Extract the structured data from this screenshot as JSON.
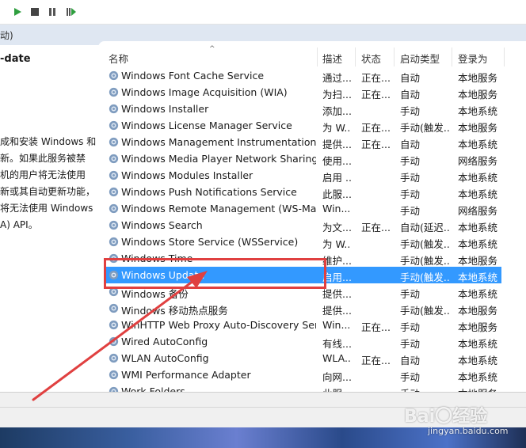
{
  "toolbar": {
    "buttons": [
      {
        "name": "start-service-button",
        "icon": "play-icon"
      },
      {
        "name": "stop-service-button",
        "icon": "stop-icon"
      },
      {
        "name": "pause-service-button",
        "icon": "pause-icon"
      },
      {
        "name": "restart-service-button",
        "icon": "restart-icon"
      }
    ]
  },
  "tabstrip": {
    "label": "动)"
  },
  "left_pane": {
    "service_name": "-date",
    "description": "成和安装 Windows 和\n新。如果此服务被禁\n机的用户将无法使用\n新或其自动更新功能，\n将无法使用 Windows\nA) API。"
  },
  "columns": {
    "name": "名称",
    "desc": "描述",
    "status": "状态",
    "startup": "启动类型",
    "logon": "登录为"
  },
  "services": [
    {
      "name": "Windows Font Cache Service",
      "desc": "通过...",
      "status": "正在...",
      "startup": "自动",
      "logon": "本地服务"
    },
    {
      "name": "Windows Image Acquisition (WIA)",
      "desc": "为扫...",
      "status": "正在...",
      "startup": "自动",
      "logon": "本地服务"
    },
    {
      "name": "Windows Installer",
      "desc": "添加...",
      "status": "",
      "startup": "手动",
      "logon": "本地系统"
    },
    {
      "name": "Windows License Manager Service",
      "desc": "为 W...",
      "status": "正在...",
      "startup": "手动(触发...",
      "logon": "本地服务"
    },
    {
      "name": "Windows Management Instrumentation",
      "desc": "提供...",
      "status": "正在...",
      "startup": "自动",
      "logon": "本地系统"
    },
    {
      "name": "Windows Media Player Network Sharing...",
      "desc": "使用...",
      "status": "",
      "startup": "手动",
      "logon": "网络服务"
    },
    {
      "name": "Windows Modules Installer",
      "desc": "启用 ...",
      "status": "",
      "startup": "手动",
      "logon": "本地系统"
    },
    {
      "name": "Windows Push Notifications Service",
      "desc": "此服...",
      "status": "",
      "startup": "手动",
      "logon": "本地系统"
    },
    {
      "name": "Windows Remote Management (WS-Ma...",
      "desc": "Win...",
      "status": "",
      "startup": "手动",
      "logon": "网络服务"
    },
    {
      "name": "Windows Search",
      "desc": "为文...",
      "status": "正在...",
      "startup": "自动(延迟...",
      "logon": "本地系统"
    },
    {
      "name": "Windows Store Service (WSService)",
      "desc": "为 W...",
      "status": "",
      "startup": "手动(触发...",
      "logon": "本地系统"
    },
    {
      "name": "Windows Time",
      "desc": "维护...",
      "status": "",
      "startup": "手动(触发...",
      "logon": "本地服务"
    },
    {
      "name": "Windows Update",
      "desc": "启用...",
      "status": "",
      "startup": "手动(触发...",
      "logon": "本地系统",
      "selected": true
    },
    {
      "name": "Windows 备份",
      "desc": "提供...",
      "status": "",
      "startup": "手动",
      "logon": "本地系统"
    },
    {
      "name": "Windows 移动热点服务",
      "desc": "提供...",
      "status": "",
      "startup": "手动(触发...",
      "logon": "本地服务"
    },
    {
      "name": "WinHTTP Web Proxy Auto-Discovery Ser...",
      "desc": "Win...",
      "status": "正在...",
      "startup": "手动",
      "logon": "本地服务"
    },
    {
      "name": "Wired AutoConfig",
      "desc": "有线...",
      "status": "",
      "startup": "手动",
      "logon": "本地系统"
    },
    {
      "name": "WLAN AutoConfig",
      "desc": "WLA...",
      "status": "正在...",
      "startup": "自动",
      "logon": "本地系统"
    },
    {
      "name": "WMI Performance Adapter",
      "desc": "向网...",
      "status": "",
      "startup": "手动",
      "logon": "本地系统"
    },
    {
      "name": "Work Folders",
      "desc": "此服...",
      "status": "",
      "startup": "手动",
      "logon": "本地服务"
    }
  ],
  "watermark": {
    "text": "Bai〇经验",
    "url": "jingyan.baidu.com"
  },
  "colors": {
    "selection": "#3399ff",
    "highlight_box": "#e04040",
    "arrow": "#e04040"
  }
}
